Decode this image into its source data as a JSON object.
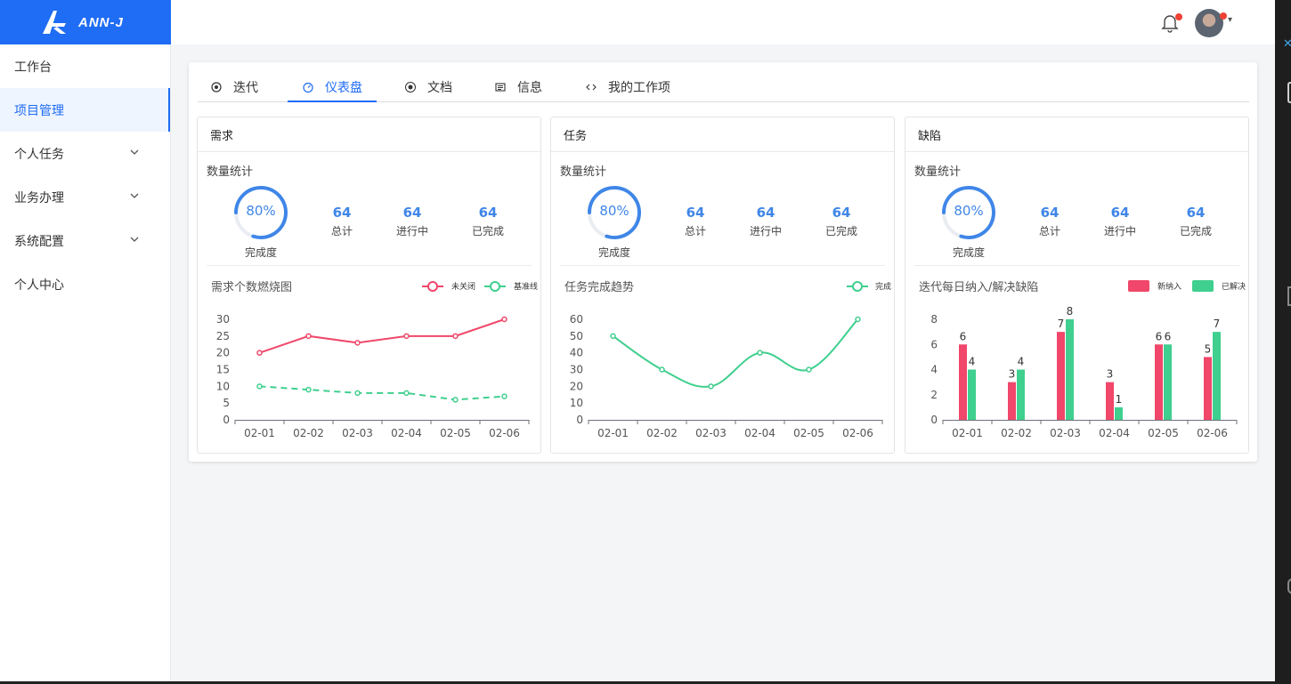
{
  "app": {
    "logo_text": "ANN-J"
  },
  "header": {
    "notification_icon": "bell-icon",
    "avatar_icon": "avatar"
  },
  "sidebar": {
    "items": [
      {
        "label": "工作台",
        "expandable": false,
        "active": false
      },
      {
        "label": "项目管理",
        "expandable": false,
        "active": true
      },
      {
        "label": "个人任务",
        "expandable": true,
        "active": false
      },
      {
        "label": "业务办理",
        "expandable": true,
        "active": false
      },
      {
        "label": "系统配置",
        "expandable": true,
        "active": false
      },
      {
        "label": "个人中心",
        "expandable": false,
        "active": false
      }
    ]
  },
  "tabs": [
    {
      "label": "迭代",
      "icon": "target-icon",
      "active": false
    },
    {
      "label": "仪表盘",
      "icon": "dashboard-icon",
      "active": true
    },
    {
      "label": "文档",
      "icon": "record-icon",
      "active": false
    },
    {
      "label": "信息",
      "icon": "newspaper-icon",
      "active": false
    },
    {
      "label": "我的工作项",
      "icon": "code-icon",
      "active": false
    }
  ],
  "colors": {
    "accent": "#1f6cf5",
    "stat_blue": "#3f86e8",
    "red": "#f0476a",
    "green": "#3fcf8e"
  },
  "panels": [
    {
      "title": "需求",
      "stats_label": "数量统计",
      "completion": {
        "value": "80%",
        "fraction": 0.8,
        "label": "完成度"
      },
      "stats": [
        {
          "value": "64",
          "label": "总计"
        },
        {
          "value": "64",
          "label": "进行中"
        },
        {
          "value": "64",
          "label": "已完成"
        }
      ],
      "chart_title": "需求个数燃烧图"
    },
    {
      "title": "任务",
      "stats_label": "数量统计",
      "completion": {
        "value": "80%",
        "fraction": 0.8,
        "label": "完成度"
      },
      "stats": [
        {
          "value": "64",
          "label": "总计"
        },
        {
          "value": "64",
          "label": "进行中"
        },
        {
          "value": "64",
          "label": "已完成"
        }
      ],
      "chart_title": "任务完成趋势"
    },
    {
      "title": "缺陷",
      "stats_label": "数量统计",
      "completion": {
        "value": "80%",
        "fraction": 0.8,
        "label": "完成度"
      },
      "stats": [
        {
          "value": "64",
          "label": "总计"
        },
        {
          "value": "64",
          "label": "进行中"
        },
        {
          "value": "64",
          "label": "已完成"
        }
      ],
      "chart_title": "迭代每日纳入/解决缺陷"
    }
  ],
  "chart_data": [
    {
      "type": "line",
      "title": "需求个数燃烧图",
      "categories": [
        "02-01",
        "02-02",
        "02-03",
        "02-04",
        "02-05",
        "02-06"
      ],
      "ylim": [
        0,
        30
      ],
      "yticks": [
        0,
        5,
        10,
        15,
        20,
        25,
        30
      ],
      "legend_position": "top-right",
      "series": [
        {
          "name": "未关闭",
          "values": [
            20,
            25,
            23,
            25,
            25,
            30
          ],
          "color": "#f0476a",
          "style": "solid"
        },
        {
          "name": "基准线",
          "values": [
            10,
            9,
            8,
            8,
            6,
            7
          ],
          "color": "#3fcf8e",
          "style": "dashed"
        }
      ]
    },
    {
      "type": "line",
      "title": "任务完成趋势",
      "categories": [
        "02-01",
        "02-02",
        "02-03",
        "02-04",
        "02-05",
        "02-06"
      ],
      "ylim": [
        0,
        60
      ],
      "yticks": [
        0,
        10,
        20,
        30,
        40,
        50,
        60
      ],
      "legend_position": "top-right",
      "smooth": true,
      "series": [
        {
          "name": "完成",
          "values": [
            50,
            30,
            20,
            40,
            30,
            60
          ],
          "color": "#3fcf8e",
          "style": "solid"
        }
      ]
    },
    {
      "type": "bar",
      "title": "迭代每日纳入/解决缺陷",
      "categories": [
        "02-01",
        "02-02",
        "02-03",
        "02-04",
        "02-05",
        "02-06"
      ],
      "ylim": [
        0,
        8
      ],
      "yticks": [
        0,
        2,
        4,
        6,
        8
      ],
      "legend_position": "top-right",
      "data_labels": true,
      "series": [
        {
          "name": "新纳入",
          "values": [
            6,
            3,
            7,
            3,
            6,
            5
          ],
          "color": "#f0476a"
        },
        {
          "name": "已解决",
          "values": [
            4,
            4,
            8,
            1,
            6,
            7
          ],
          "color": "#3fcf8e"
        }
      ]
    }
  ]
}
